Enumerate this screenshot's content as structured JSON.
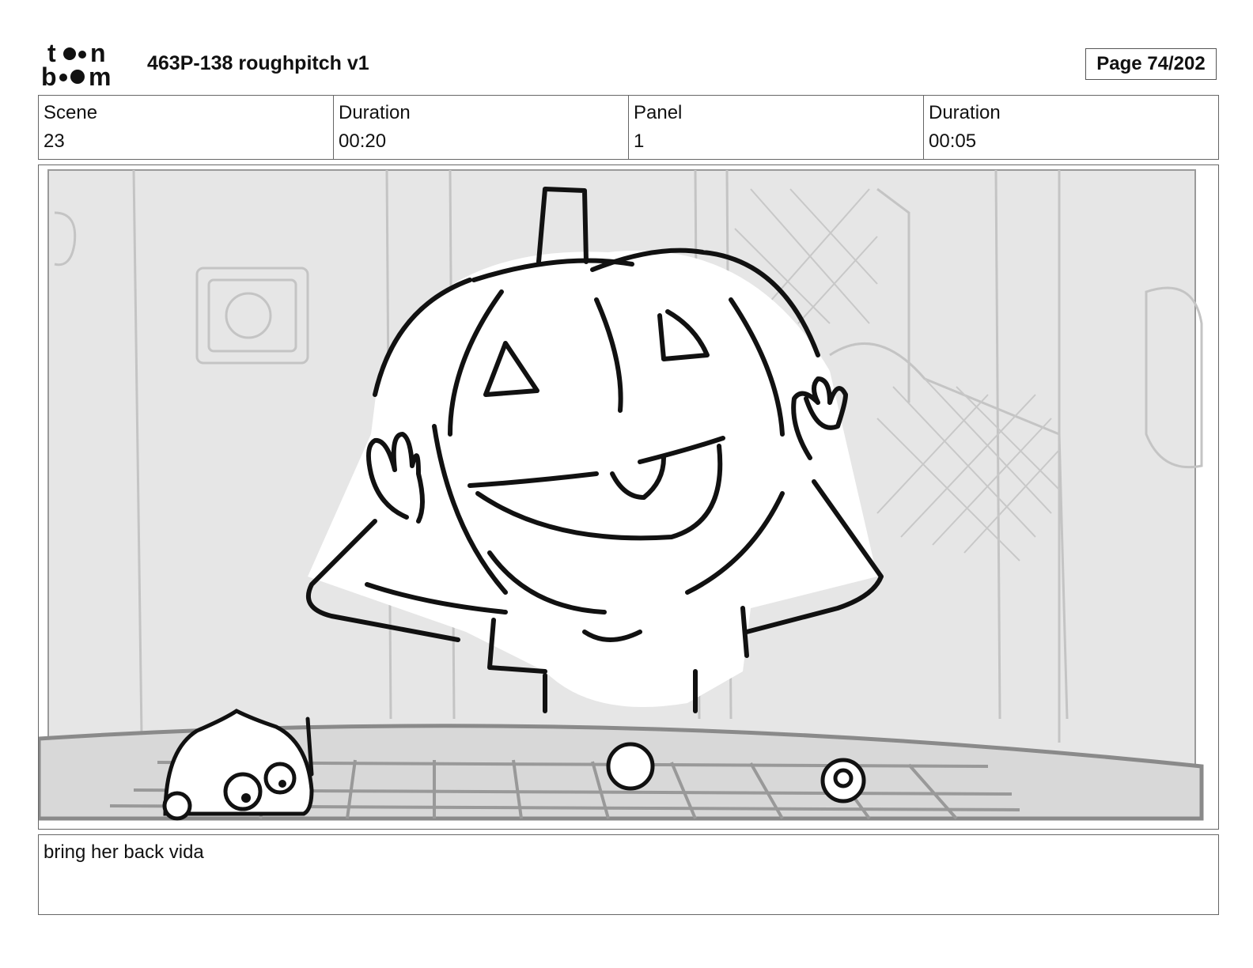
{
  "header": {
    "title": "463P-138 roughpitch v1",
    "page_label": "Page",
    "page_number": "74/202"
  },
  "info": {
    "scene_label": "Scene",
    "scene_value": "23",
    "scene_duration_label": "Duration",
    "scene_duration_value": "00:20",
    "panel_label": "Panel",
    "panel_value": "1",
    "panel_duration_label": "Duration",
    "panel_duration_value": "00:05"
  },
  "caption": {
    "text": "bring her back vida"
  }
}
